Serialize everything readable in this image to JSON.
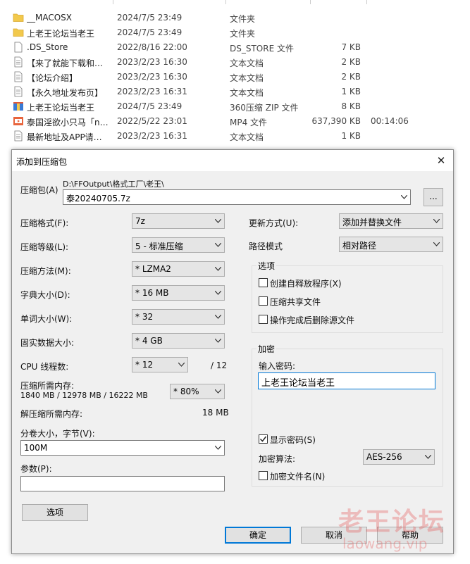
{
  "files": [
    {
      "icon": "folder-icon",
      "name": "__MACOSX",
      "date": "2024/7/5 23:49",
      "type": "文件夹",
      "size": "",
      "duration": ""
    },
    {
      "icon": "folder-icon",
      "name": "上老王论坛当老王",
      "date": "2024/7/5 23:49",
      "type": "文件夹",
      "size": "",
      "duration": ""
    },
    {
      "icon": "file-icon",
      "name": ".DS_Store",
      "date": "2022/8/16 22:00",
      "type": "DS_STORE 文件",
      "size": "7 KB",
      "duration": ""
    },
    {
      "icon": "text-file-icon",
      "name": "【来了就能下载和…",
      "date": "2023/2/23 16:30",
      "type": "文本文档",
      "size": "2 KB",
      "duration": ""
    },
    {
      "icon": "text-file-icon",
      "name": "【论坛介绍】",
      "date": "2023/2/23 16:30",
      "type": "文本文档",
      "size": "2 KB",
      "duration": ""
    },
    {
      "icon": "text-file-icon",
      "name": "【永久地址发布页】",
      "date": "2023/2/23 16:31",
      "type": "文本文档",
      "size": "1 KB",
      "duration": ""
    },
    {
      "icon": "zip-file-icon",
      "name": "上老王论坛当老王",
      "date": "2024/7/5 23:49",
      "type": "360压缩 ZIP 文件",
      "size": "8 KB",
      "duration": ""
    },
    {
      "icon": "mp4-file-icon",
      "name": "泰国淫欲小只马「n…",
      "date": "2022/5/22 23:01",
      "type": "MP4 文件",
      "size": "637,390 KB",
      "duration": "00:14:06"
    },
    {
      "icon": "text-file-icon",
      "name": "最新地址及APP请…",
      "date": "2023/2/23 16:31",
      "type": "文本文档",
      "size": "1 KB",
      "duration": ""
    }
  ],
  "dialog": {
    "title": "添加到压缩包",
    "archive_label": "压缩包(A)",
    "archive_path": "D:\\FFOutput\\格式工厂\\老王\\",
    "archive_name": "泰20240705.7z",
    "browse_label": "...",
    "format_label": "压缩格式(F):",
    "format_value": "7z",
    "level_label": "压缩等级(L):",
    "level_value": "5 - 标准压缩",
    "method_label": "压缩方法(M):",
    "method_value": "* LZMA2",
    "dict_label": "字典大小(D):",
    "dict_value": "* 16 MB",
    "word_label": "单词大小(W):",
    "word_value": "* 32",
    "solid_label": "固实数据大小:",
    "solid_value": "* 4 GB",
    "cpu_label": "CPU 线程数:",
    "cpu_value": "* 12",
    "cpu_max": "/ 12",
    "mem_label": "压缩所需内存:",
    "mem_detail": "1840 MB / 12978 MB / 16222 MB",
    "mem_value": "* 80%",
    "decomp_label": "解压缩所需内存:",
    "decomp_value": "18 MB",
    "split_label": "分卷大小，字节(V):",
    "split_value": "100M",
    "params_label": "参数(P):",
    "params_value": "",
    "options_button": "选项",
    "update_label": "更新方式(U):",
    "update_value": "添加并替换文件",
    "pathmode_label": "路径模式",
    "pathmode_value": "相对路径",
    "options_group": "选项",
    "opt_sfx": "创建自释放程序(X)",
    "opt_shared": "压缩共享文件",
    "opt_delete": "操作完成后删除源文件",
    "encrypt_group": "加密",
    "password_label": "输入密码:",
    "password_value": "上老王论坛当老王",
    "show_password": "显示密码(S)",
    "enc_method_label": "加密算法:",
    "enc_method_value": "AES-256",
    "enc_names": "加密文件名(N)",
    "ok": "确定",
    "cancel": "取消",
    "help": "帮助"
  },
  "watermark": {
    "line1": "老王论坛",
    "line2": "laowang.vip"
  },
  "colors": {
    "accent": "#0078d7",
    "folder": "#f2c94c",
    "dialog_bg": "#f0f0f0"
  }
}
